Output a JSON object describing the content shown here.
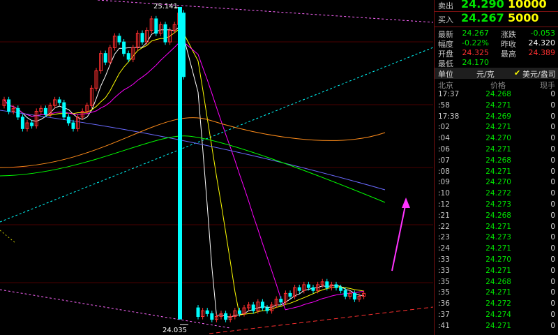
{
  "chart": {
    "high_label": "25.141",
    "low_label": "24.035",
    "colors": {
      "up": "#ff3030",
      "down": "#00ffff",
      "ma5": "#ffffff",
      "ma10": "#ffff00",
      "ma20": "#ff00ff",
      "ma60": "#00ff00",
      "ma_orange": "#ff8c1a",
      "ma_blue": "#6a6aff",
      "trend": "#00ffff",
      "grid": "#4a0000"
    }
  },
  "quote": {
    "sell_label": "卖出",
    "sell_price": "24.290",
    "sell_vol": "10000",
    "buy_label": "买入",
    "buy_price": "24.267",
    "buy_vol": "5000"
  },
  "stats": [
    {
      "l1": "最新",
      "v1": "24.267",
      "c1": "#00e600",
      "l2": "涨跌",
      "v2": "-0.053",
      "c2": "#00e600"
    },
    {
      "l1": "幅度",
      "v1": "-0.22%",
      "c1": "#00e600",
      "l2": "昨收",
      "v2": "24.320",
      "c2": "#ffffff"
    },
    {
      "l1": "开盘",
      "v1": "24.325",
      "c1": "#ff3030",
      "l2": "最高",
      "v2": "24.389",
      "c2": "#ff3030"
    },
    {
      "l1": "最低",
      "v1": "24.170",
      "c1": "#00e600",
      "l2": "",
      "v2": "",
      "c2": "#ffffff"
    }
  ],
  "unit": {
    "label": "单位",
    "value": "元/克",
    "checkbox_label": "美元/盎司"
  },
  "ticks_header": {
    "time": "北京",
    "price": "价格",
    "vol": "现手"
  },
  "ticks": [
    {
      "t": "17:37",
      "p": "24.268",
      "v": "0"
    },
    {
      "t": ":58",
      "p": "24.271",
      "v": "0"
    },
    {
      "t": "17:38",
      "p": "24.269",
      "v": "0"
    },
    {
      "t": ":02",
      "p": "24.271",
      "v": "0"
    },
    {
      "t": ":04",
      "p": "24.270",
      "v": "0"
    },
    {
      "t": ":06",
      "p": "24.271",
      "v": "0"
    },
    {
      "t": ":07",
      "p": "24.268",
      "v": "0"
    },
    {
      "t": ":08",
      "p": "24.271",
      "v": "0"
    },
    {
      "t": ":09",
      "p": "24.270",
      "v": "0"
    },
    {
      "t": ":10",
      "p": "24.272",
      "v": "0"
    },
    {
      "t": ":12",
      "p": "24.273",
      "v": "0"
    },
    {
      "t": ":21",
      "p": "24.268",
      "v": "0"
    },
    {
      "t": ":22",
      "p": "24.271",
      "v": "0"
    },
    {
      "t": ":23",
      "p": "24.273",
      "v": "0"
    },
    {
      "t": ":24",
      "p": "24.271",
      "v": "0"
    },
    {
      "t": ":33",
      "p": "24.270",
      "v": "0"
    },
    {
      "t": ":33",
      "p": "24.271",
      "v": "0"
    },
    {
      "t": ":35",
      "p": "24.268",
      "v": "0"
    },
    {
      "t": ":35",
      "p": "24.271",
      "v": "0"
    },
    {
      "t": ":36",
      "p": "24.272",
      "v": "0"
    },
    {
      "t": ":37",
      "p": "24.274",
      "v": "0"
    },
    {
      "t": ":41",
      "p": "24.271",
      "v": "0"
    }
  ]
}
